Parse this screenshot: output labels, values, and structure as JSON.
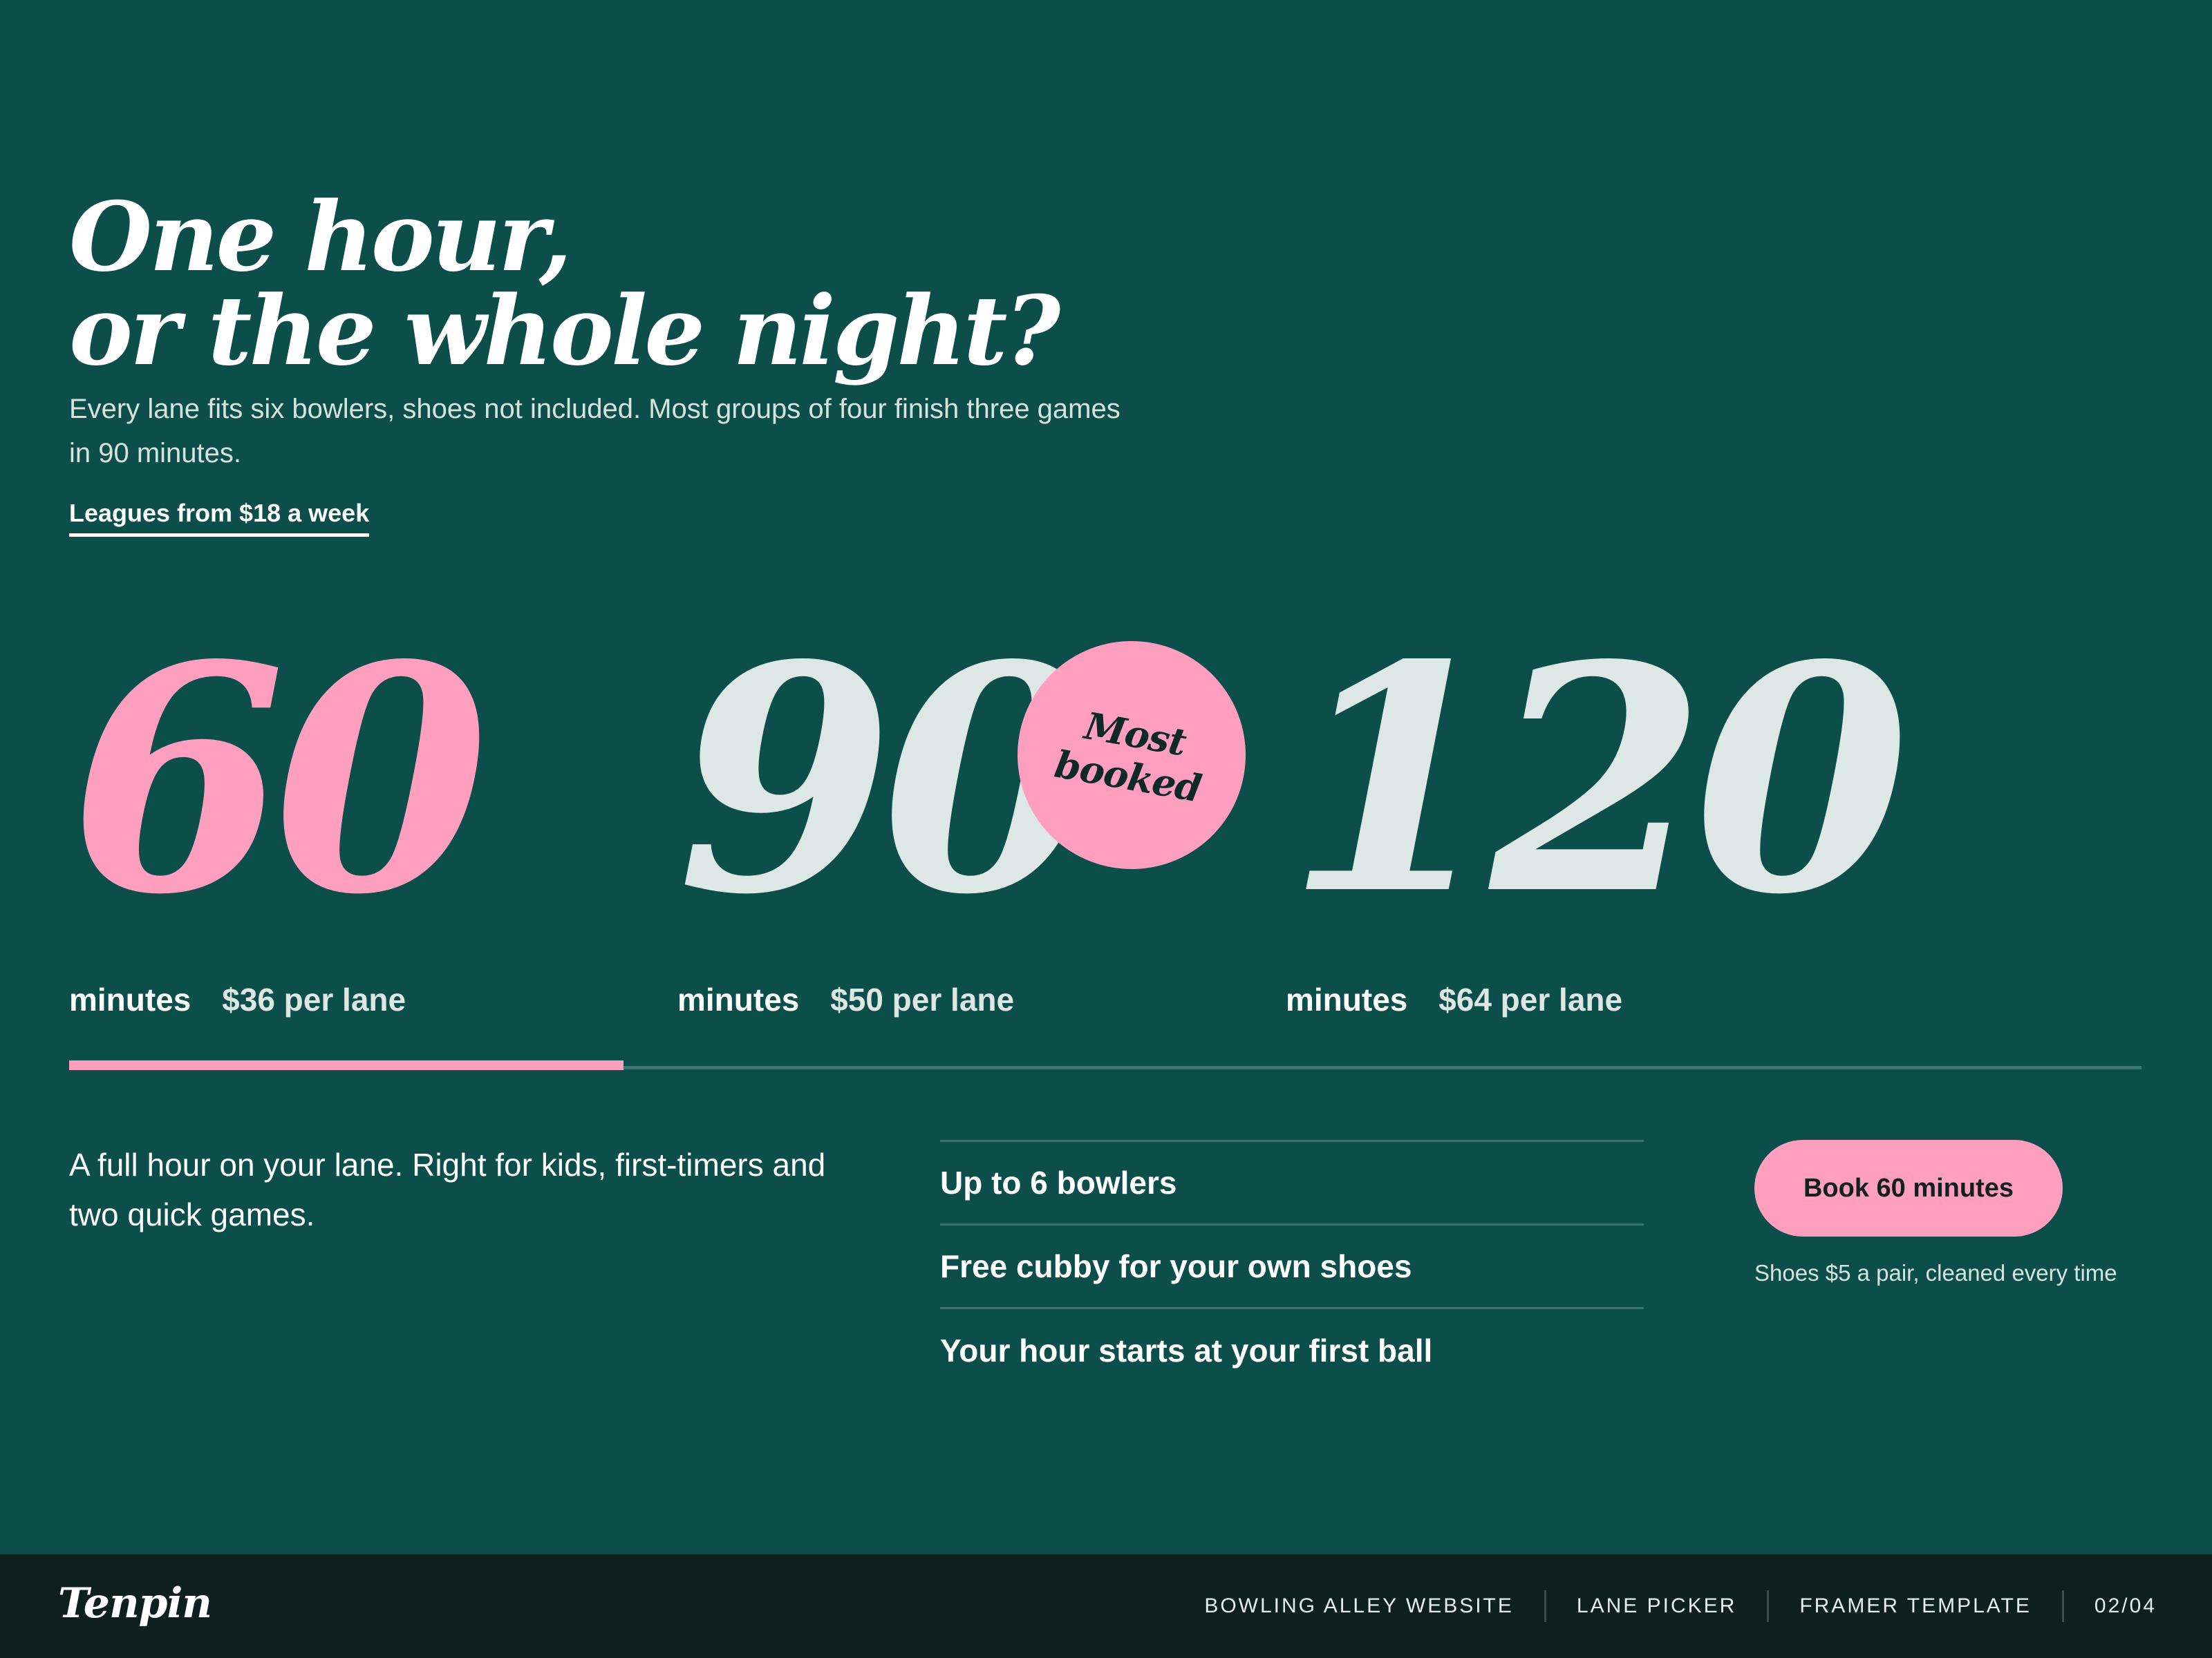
{
  "hero": {
    "title_line1": "One hour,",
    "title_line2": "or the whole night?",
    "subtitle": "Every lane fits six bowlers, shoes not included. Most groups of four finish three games in 90 minutes.",
    "league_link": "Leagues from $18 a week"
  },
  "options": [
    {
      "minutes": "60",
      "unit": "minutes",
      "price": "$36 per lane",
      "selected": true
    },
    {
      "minutes": "90",
      "unit": "minutes",
      "price": "$50 per lane",
      "selected": false
    },
    {
      "minutes": "120",
      "unit": "minutes",
      "price": "$64 per lane",
      "selected": false
    }
  ],
  "badge": {
    "line1": "Most",
    "line2": "booked"
  },
  "detail": {
    "description": "A full hour on your lane. Right for kids, first-timers and two quick games.",
    "features": [
      "Up to 6 bowlers",
      "Free cubby for your own shoes",
      "Your hour starts at your first ball"
    ],
    "cta": "Book 60 minutes",
    "note": "Shoes $5 a pair, cleaned every time"
  },
  "footer": {
    "logo": "Tenpin",
    "nav": [
      "BOWLING ALLEY WEBSITE",
      "LANE PICKER",
      "FRAMER TEMPLATE",
      "02/04"
    ]
  },
  "colors": {
    "background": "#0c4f4a",
    "accent_pink": "#ff9fbf",
    "footer_bg": "#0d201e",
    "muted_number": "#dde8e6"
  }
}
